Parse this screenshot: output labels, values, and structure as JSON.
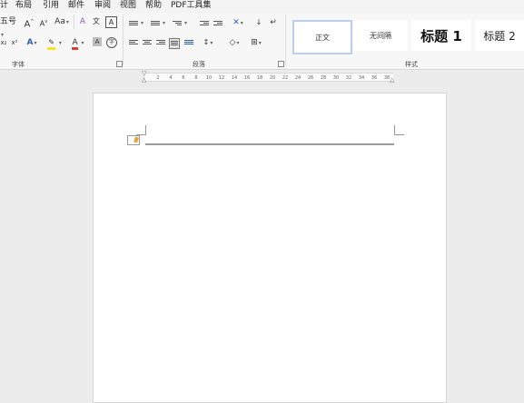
{
  "menu": {
    "items": [
      "计",
      "布局",
      "引用",
      "邮件",
      "审阅",
      "视图",
      "帮助",
      "PDF工具集"
    ]
  },
  "ribbon": {
    "font_group_label": "字体",
    "paragraph_group_label": "段落",
    "styles_group_label": "样式",
    "font_size_fragment": "五号",
    "grow_font": "A",
    "shrink_font": "A",
    "change_case": "Aa",
    "clear_format": "A",
    "phonetic": "文",
    "char_border": "A",
    "subscript": "x₂",
    "superscript": "x²",
    "text_effect": "A",
    "font_color": "A",
    "char_shading": "A",
    "enclose_char": "字",
    "styles": [
      {
        "label": "正文"
      },
      {
        "label": "无间隔"
      },
      {
        "label": "标题 1"
      },
      {
        "label": "标题 2"
      }
    ]
  },
  "ruler": {
    "ticks": [
      "2",
      "4",
      "6",
      "8",
      "10",
      "12",
      "14",
      "16",
      "18",
      "20",
      "22",
      "24",
      "26",
      "28",
      "30",
      "32",
      "34",
      "36",
      "38"
    ]
  },
  "colors": {
    "highlight": "#f2e32b",
    "font_color_bar": "#e23b2a",
    "selected_style_border": "#bcd0ec",
    "accent_blue": "#2f5fb3"
  }
}
